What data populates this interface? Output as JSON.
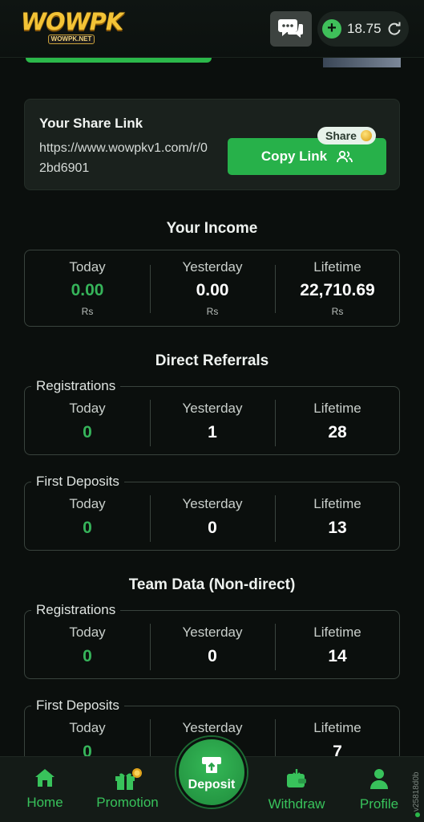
{
  "header": {
    "logo_text": "WOWPK",
    "logo_sub": "WOWPK.NET",
    "balance": "18.75"
  },
  "share": {
    "title": "Your Share Link",
    "url": "https://www.wowpkv1.com/r/02bd6901",
    "copy_label": "Copy Link",
    "badge": "Share"
  },
  "income": {
    "title": "Your Income",
    "columns": [
      {
        "label": "Today",
        "value": "0.00",
        "unit": "Rs"
      },
      {
        "label": "Yesterday",
        "value": "0.00",
        "unit": "Rs"
      },
      {
        "label": "Lifetime",
        "value": "22,710.69",
        "unit": "Rs"
      }
    ]
  },
  "direct": {
    "title": "Direct Referrals",
    "registrations": {
      "legend": "Registrations",
      "columns": [
        {
          "label": "Today",
          "value": "0"
        },
        {
          "label": "Yesterday",
          "value": "1"
        },
        {
          "label": "Lifetime",
          "value": "28"
        }
      ]
    },
    "first_deposits": {
      "legend": "First Deposits",
      "columns": [
        {
          "label": "Today",
          "value": "0"
        },
        {
          "label": "Yesterday",
          "value": "0"
        },
        {
          "label": "Lifetime",
          "value": "13"
        }
      ]
    }
  },
  "team": {
    "title": "Team Data (Non-direct)",
    "registrations": {
      "legend": "Registrations",
      "columns": [
        {
          "label": "Today",
          "value": "0"
        },
        {
          "label": "Yesterday",
          "value": "0"
        },
        {
          "label": "Lifetime",
          "value": "14"
        }
      ]
    },
    "first_deposits": {
      "legend": "First Deposits",
      "columns": [
        {
          "label": "Today",
          "value": "0"
        },
        {
          "label": "Yesterday",
          "value": ""
        },
        {
          "label": "Lifetime",
          "value": "7"
        }
      ]
    }
  },
  "nav": {
    "home": "Home",
    "promotion": "Promotion",
    "deposit": "Deposit",
    "withdraw": "Withdraw",
    "profile": "Profile"
  },
  "version_tag": "v25818d0b",
  "colors": {
    "accent_green": "#27b14a",
    "background": "#0b0f0d",
    "today_green": "#36b45a"
  }
}
